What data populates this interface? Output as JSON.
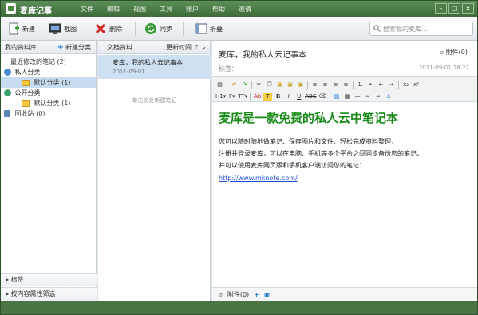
{
  "app": {
    "title": "麦库记事"
  },
  "menu": [
    "文件",
    "编辑",
    "视图",
    "工具",
    "账户",
    "帮助",
    "邀请"
  ],
  "window_controls": {
    "minimize": "–",
    "maximize": "□",
    "close": "×"
  },
  "toolbar": {
    "new_label": "新建",
    "screenshot_label": "截图",
    "delete_label": "删除",
    "sync_label": "同步",
    "collapse_label": "折叠",
    "search_placeholder": "搜索我的麦库..."
  },
  "left": {
    "header_title": "我的资料库",
    "new_category": "新建分类",
    "recent": "最近修改的笔记 (2)",
    "private": "私人分类",
    "private_default": "默认分类 (1)",
    "public": "公开分类",
    "public_default": "默认分类 (1)",
    "recycle": "回收站 (0)",
    "tags": "标签",
    "attr_filter": "按内容属性筛选"
  },
  "middle": {
    "header_title": "文档资料",
    "sort_label": "更新时间 ↑",
    "notes": [
      {
        "title": "麦库，我的私人云记事本",
        "date": "2011-09-01"
      }
    ],
    "hint": "单击此处新建笔记"
  },
  "editor": {
    "title": "麦库，我的私人云记事本",
    "attach": "附件(0)",
    "tags_label": "标签：",
    "date": "2011-09-01 18:22",
    "heading": "麦库是一款免费的私人云中笔记本",
    "paragraphs": [
      "您可以随时随地做笔记、保存图片和文件、轻松完成资料整理，",
      "注册并登录麦库，可以在电脑、手机等多个平台之间同步备份您的笔记，",
      "并可以使用麦库网页版和手机客户端访问您的笔记："
    ],
    "link": "http://www.mknote.com/",
    "footer_attach": "附件(0)"
  },
  "colors": {
    "accent": "#3d6b39",
    "heading": "#1a8a1a",
    "link": "#1a4fd6",
    "selection": "#cfe0f3"
  }
}
